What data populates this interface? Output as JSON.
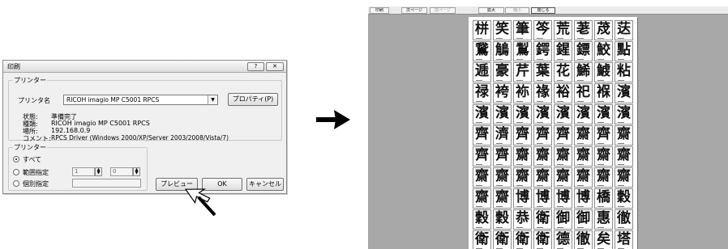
{
  "dialog": {
    "title": "印刷",
    "help_label": "?",
    "close_label": "✕",
    "printer_group_label": "プリンター",
    "printer_name_label": "プリンタ名",
    "printer_name_value": "RICOH imagio MP C5001 RPCS",
    "properties_label": "プロパティ(P)",
    "status_label": "状態:",
    "status_value": "準備完了",
    "type_label": "種類:",
    "type_value": "RICOH imagio MP C5001 RPCS",
    "location_label": "場所:",
    "location_value": "192.168.0.9",
    "comment_label": "コメント:",
    "comment_value": "RPCS Driver (Windows 2000/XP/Server 2003/2008/Vista/7)",
    "range_group_label": "プリンター",
    "all_label": "すべて",
    "range_label": "範囲指定",
    "range_from": "1",
    "range_to": "0",
    "individual_label": "個別指定",
    "selected_range": "all",
    "preview_label": "プレビュー",
    "ok_label": "OK",
    "cancel_label": "キャンセル"
  },
  "preview": {
    "toolbar": {
      "print_label": "印刷",
      "next_label": "次ページ",
      "prev_label": "前ページ",
      "zoom_in_label": "拡大",
      "zoom_out_label": "縮小",
      "close_label": "閉じる"
    },
    "characters": [
      "栟",
      "笑",
      "筆",
      "笒",
      "荒",
      "荖",
      "荗",
      "荙",
      "鵞",
      "鵤",
      "鵥",
      "鍔",
      "鍟",
      "鏢",
      "鮫",
      "點",
      "逓",
      "豪",
      "芹",
      "葉",
      "花",
      "鯑",
      "鰬",
      "粘",
      "禄",
      "袴",
      "袮",
      "禒",
      "裕",
      "祀",
      "褓",
      "濱",
      "濱",
      "濱",
      "濱",
      "濱",
      "濱",
      "濱",
      "濱",
      "濱",
      "齊",
      "濟",
      "齊",
      "齊",
      "齊",
      "齋",
      "齊",
      "齋",
      "齊",
      "齊",
      "齋",
      "齋",
      "齋",
      "齋",
      "齋",
      "齋",
      "齋",
      "齋",
      "齋",
      "齋",
      "齋",
      "齋",
      "齋",
      "齋",
      "齋",
      "齋",
      "博",
      "博",
      "博",
      "博",
      "橋",
      "穀",
      "穀",
      "穀",
      "恭",
      "衛",
      "御",
      "御",
      "惠",
      "徹",
      "衛",
      "衛",
      "衛",
      "衛",
      "德",
      "徹",
      "矣",
      "塔"
    ]
  }
}
